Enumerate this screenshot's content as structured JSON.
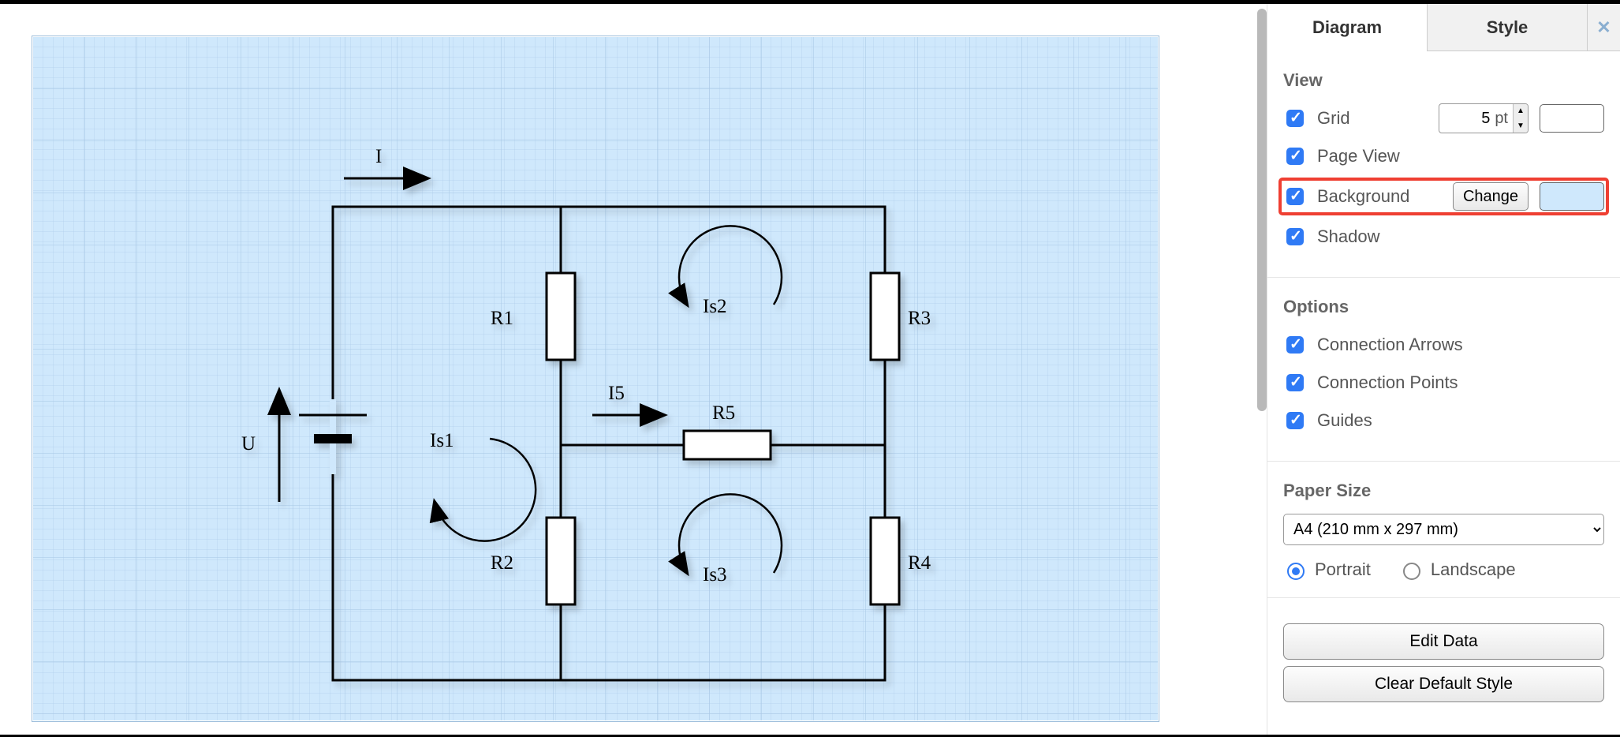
{
  "tabs": {
    "diagram": "Diagram",
    "style": "Style"
  },
  "view": {
    "header": "View",
    "grid": "Grid",
    "grid_value": "5",
    "grid_unit": "pt",
    "page_view": "Page View",
    "background": "Background",
    "change": "Change",
    "shadow": "Shadow",
    "bg_color": "#cfe8fc"
  },
  "options": {
    "header": "Options",
    "conn_arrows": "Connection Arrows",
    "conn_points": "Connection Points",
    "guides": "Guides"
  },
  "paper": {
    "header": "Paper Size",
    "selected": "A4 (210 mm x 297 mm)",
    "portrait": "Portrait",
    "landscape": "Landscape"
  },
  "buttons": {
    "edit_data": "Edit Data",
    "clear_style": "Clear Default Style"
  },
  "circuit": {
    "U": "U",
    "I": "I",
    "I5": "I5",
    "R1": "R1",
    "R2": "R2",
    "R3": "R3",
    "R4": "R4",
    "R5": "R5",
    "Is1": "Is1",
    "Is2": "Is2",
    "Is3": "Is3"
  }
}
